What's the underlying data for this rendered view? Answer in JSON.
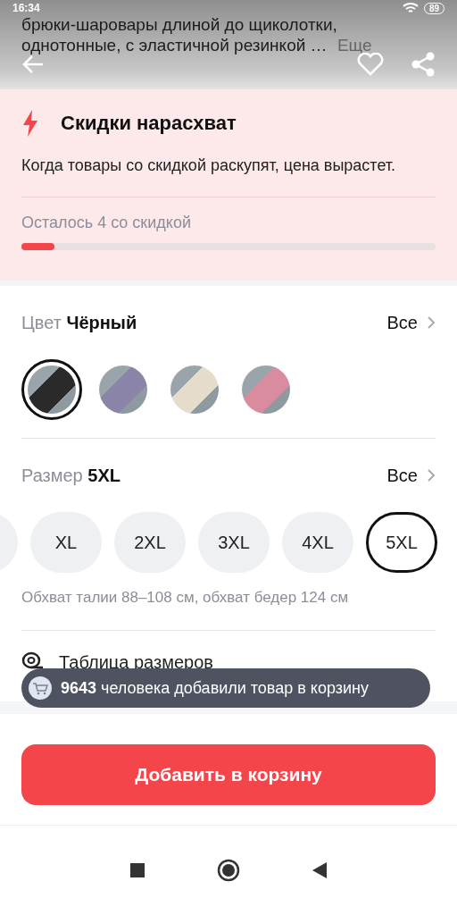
{
  "status_bar": {
    "time": "16:34",
    "battery": "89"
  },
  "header": {
    "description_lines": [
      "брюки-шаровары длиной до щиколотки,",
      "однотонные, с эластичной резинкой …"
    ],
    "more": "Еще"
  },
  "flash_sale": {
    "title": "Скидки нарасхват",
    "text": "Когда товары со скидкой раскупят, цена вырастет.",
    "remaining": "Осталось 4 со скидкой",
    "level": 0.08
  },
  "color": {
    "label": "Цвет",
    "value": "Чёрный",
    "all": "Все",
    "swatches": [
      {
        "selected": true
      },
      {
        "selected": false
      },
      {
        "selected": false
      },
      {
        "selected": false
      }
    ]
  },
  "size": {
    "label": "Размер",
    "value": "5XL",
    "all": "Все",
    "options": [
      {
        "label": "XL",
        "selected": false
      },
      {
        "label": "2XL",
        "selected": false
      },
      {
        "label": "3XL",
        "selected": false
      },
      {
        "label": "4XL",
        "selected": false
      },
      {
        "label": "5XL",
        "selected": true
      }
    ],
    "measure": "Обхват талии 88–108 см, обхват бедер 124 см",
    "size_table": "Таблица размеров"
  },
  "toast": {
    "count": "9643",
    "text": "человека добавили товар в корзину"
  },
  "add_to_cart": "Добавить в корзину"
}
